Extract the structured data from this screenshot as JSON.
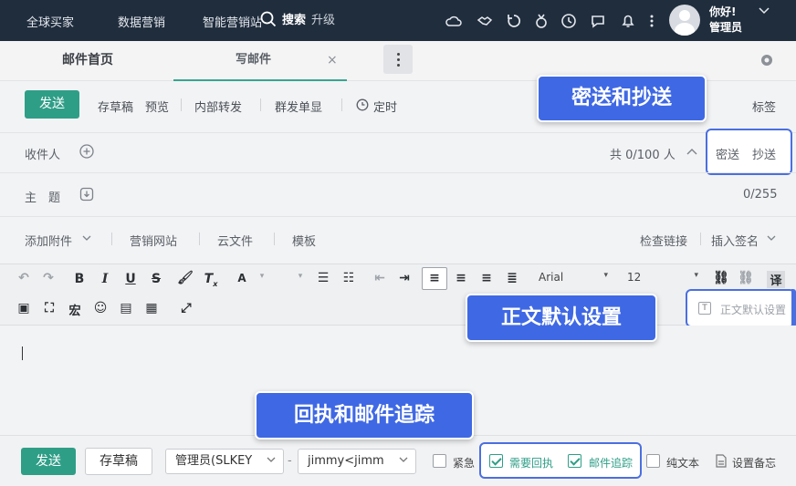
{
  "topnav": {
    "items": [
      "全球买家",
      "数据营销",
      "智能营销站"
    ],
    "search_label": "搜索",
    "search_suffix": "升级",
    "greeting": "你好!",
    "role": "管理员"
  },
  "tabs": {
    "home": "邮件首页",
    "compose": "写邮件",
    "close_glyph": "×"
  },
  "toolbar": {
    "send": "发送",
    "draft": "存草稿",
    "preview": "预览",
    "forward": "内部转发",
    "group_send": "群发单显",
    "schedule": "定时",
    "tags": "标签"
  },
  "recipients": {
    "label": "收件人",
    "count": "共 0/100 人",
    "bcc": "密送",
    "cc": "抄送"
  },
  "subject": {
    "label": "主　题",
    "count": "0/255"
  },
  "attach_row": {
    "attachment": "添加附件",
    "marketing_site": "营销网站",
    "cloud_file": "云文件",
    "template": "模板",
    "check_links": "检查链接",
    "insert_signature": "插入签名"
  },
  "editor": {
    "font": "Arial",
    "size": "12",
    "default_setting": "正文默认设置",
    "translate_glyph": "译",
    "macro_glyph": "宏"
  },
  "bottom": {
    "send": "发送",
    "draft": "存草稿",
    "sender": "管理员(SLKEY",
    "dash": "-",
    "account": "jimmy<jimm",
    "urgent": "紧急",
    "read_receipt": "需要回执",
    "tracking": "邮件追踪",
    "plain_text": "纯文本",
    "memo": "设置备忘",
    "read_receipt_checked": true,
    "tracking_checked": true,
    "urgent_checked": false,
    "plain_text_checked": false
  },
  "callouts": {
    "bcc_cc": "密送和抄送",
    "default_body": "正文默认设置",
    "receipt_tracking": "回执和邮件追踪"
  },
  "colors": {
    "primary": "#2f9e87",
    "nav_bg": "#202d3d",
    "callout": "#3f68e4"
  }
}
